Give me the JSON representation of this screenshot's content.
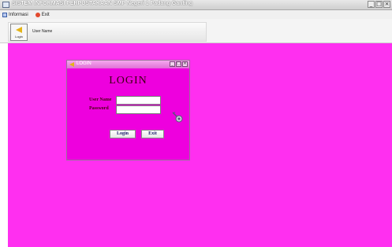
{
  "main_window": {
    "title": "SISTEM INFORMASI PERPUSTAKAAN SMP Negeri 1 Padang Ganting",
    "controls": [
      "_",
      "□",
      "×"
    ]
  },
  "menubar": {
    "items": [
      {
        "label": "Informasi",
        "icon": "info-icon"
      },
      {
        "label": "Exit",
        "icon": "exit-icon"
      }
    ]
  },
  "toolbar": {
    "login_label": "Login",
    "user_label": "User Name"
  },
  "colors": {
    "desktop": "#ff2ff0",
    "login_window": "#ee00de"
  },
  "login_dialog": {
    "title": "LOGIN",
    "heading": "LOGIN",
    "username_label": "User Name",
    "password_label": "Password",
    "username_value": "",
    "password_value": "",
    "login_button": "Login",
    "exit_button": "Exit",
    "controls": [
      "_",
      "□",
      "×"
    ]
  }
}
